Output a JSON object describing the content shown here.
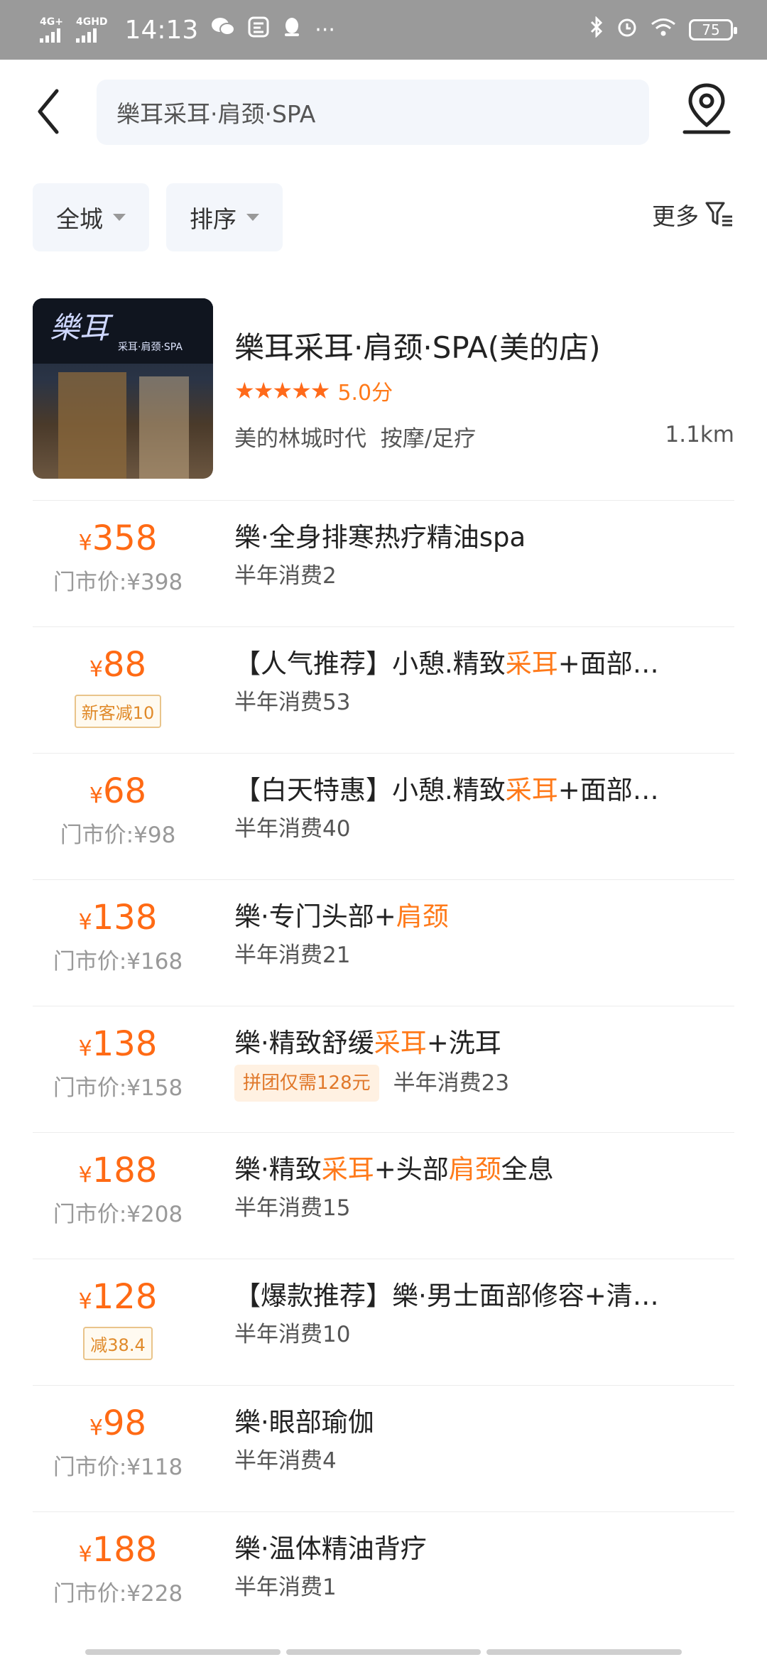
{
  "status_bar": {
    "net1": "4G+",
    "net2": "4GHD",
    "time": "14:13",
    "battery": "75",
    "icons": [
      "wechat-icon",
      "app-icon",
      "qq-icon",
      "more-dots-icon",
      "bluetooth-icon",
      "alarm-icon",
      "wifi-icon",
      "battery-icon"
    ],
    "dots": "···"
  },
  "header": {
    "search_value": "樂耳采耳·肩颈·SPA",
    "back_icon": "chevron-left-icon",
    "map_icon": "map-pin-icon"
  },
  "filters": {
    "city": "全城",
    "sort": "排序",
    "more": "更多"
  },
  "shop": {
    "name": "樂耳采耳·肩颈·SPA(美的店)",
    "stars": "★★★★★",
    "score": "5.0分",
    "location": "美的林城时代",
    "category": "按摩/足疗",
    "distance": "1.1km",
    "image_logo": "樂耳",
    "image_sub": "采耳·肩颈·SPA"
  },
  "deals": [
    {
      "yen": "¥",
      "price": "358",
      "orig": "门市价:¥398",
      "title_pre": "樂·全身排寒热疗精油spa",
      "title_hl": "",
      "title_post": "",
      "title_hl2": "",
      "title_post2": "",
      "sales": "半年消费2"
    },
    {
      "yen": "¥",
      "price": "88",
      "tag": "新客减10",
      "title_pre": "【人气推荐】小憩.精致",
      "title_hl": "采耳",
      "title_post": "+面部…",
      "title_hl2": "",
      "title_post2": "",
      "sales": "半年消费53"
    },
    {
      "yen": "¥",
      "price": "68",
      "orig": "门市价:¥98",
      "title_pre": "【白天特惠】小憩.精致",
      "title_hl": "采耳",
      "title_post": "+面部…",
      "title_hl2": "",
      "title_post2": "",
      "sales": "半年消费40"
    },
    {
      "yen": "¥",
      "price": "138",
      "orig": "门市价:¥168",
      "title_pre": "樂·专门头部+",
      "title_hl": "肩颈",
      "title_post": "",
      "title_hl2": "",
      "title_post2": "",
      "sales": "半年消费21"
    },
    {
      "yen": "¥",
      "price": "138",
      "orig": "门市价:¥158",
      "title_pre": "樂·精致舒缓",
      "title_hl": "采耳",
      "title_post": "+洗耳",
      "title_hl2": "",
      "title_post2": "",
      "group": "拼团仅需128元",
      "sales": "半年消费23"
    },
    {
      "yen": "¥",
      "price": "188",
      "orig": "门市价:¥208",
      "title_pre": "樂·精致",
      "title_hl": "采耳",
      "title_post": "+头部",
      "title_hl2": "肩颈",
      "title_post2": "全息",
      "sales": "半年消费15"
    },
    {
      "yen": "¥",
      "price": "128",
      "tag": "减38.4",
      "title_pre": "【爆款推荐】樂·男士面部修容+清…",
      "title_hl": "",
      "title_post": "",
      "title_hl2": "",
      "title_post2": "",
      "sales": "半年消费10"
    },
    {
      "yen": "¥",
      "price": "98",
      "orig": "门市价:¥118",
      "title_pre": "樂·眼部瑜伽",
      "title_hl": "",
      "title_post": "",
      "title_hl2": "",
      "title_post2": "",
      "sales": "半年消费4"
    },
    {
      "yen": "¥",
      "price": "188",
      "orig": "门市价:¥228",
      "title_pre": "樂·温体精油背疗",
      "title_hl": "",
      "title_post": "",
      "title_hl2": "",
      "title_post2": "",
      "sales": "半年消费1"
    }
  ],
  "colors": {
    "accent": "#ff6a14",
    "status_bar": "#9a9a9a",
    "search_bg": "#f3f6fb"
  }
}
